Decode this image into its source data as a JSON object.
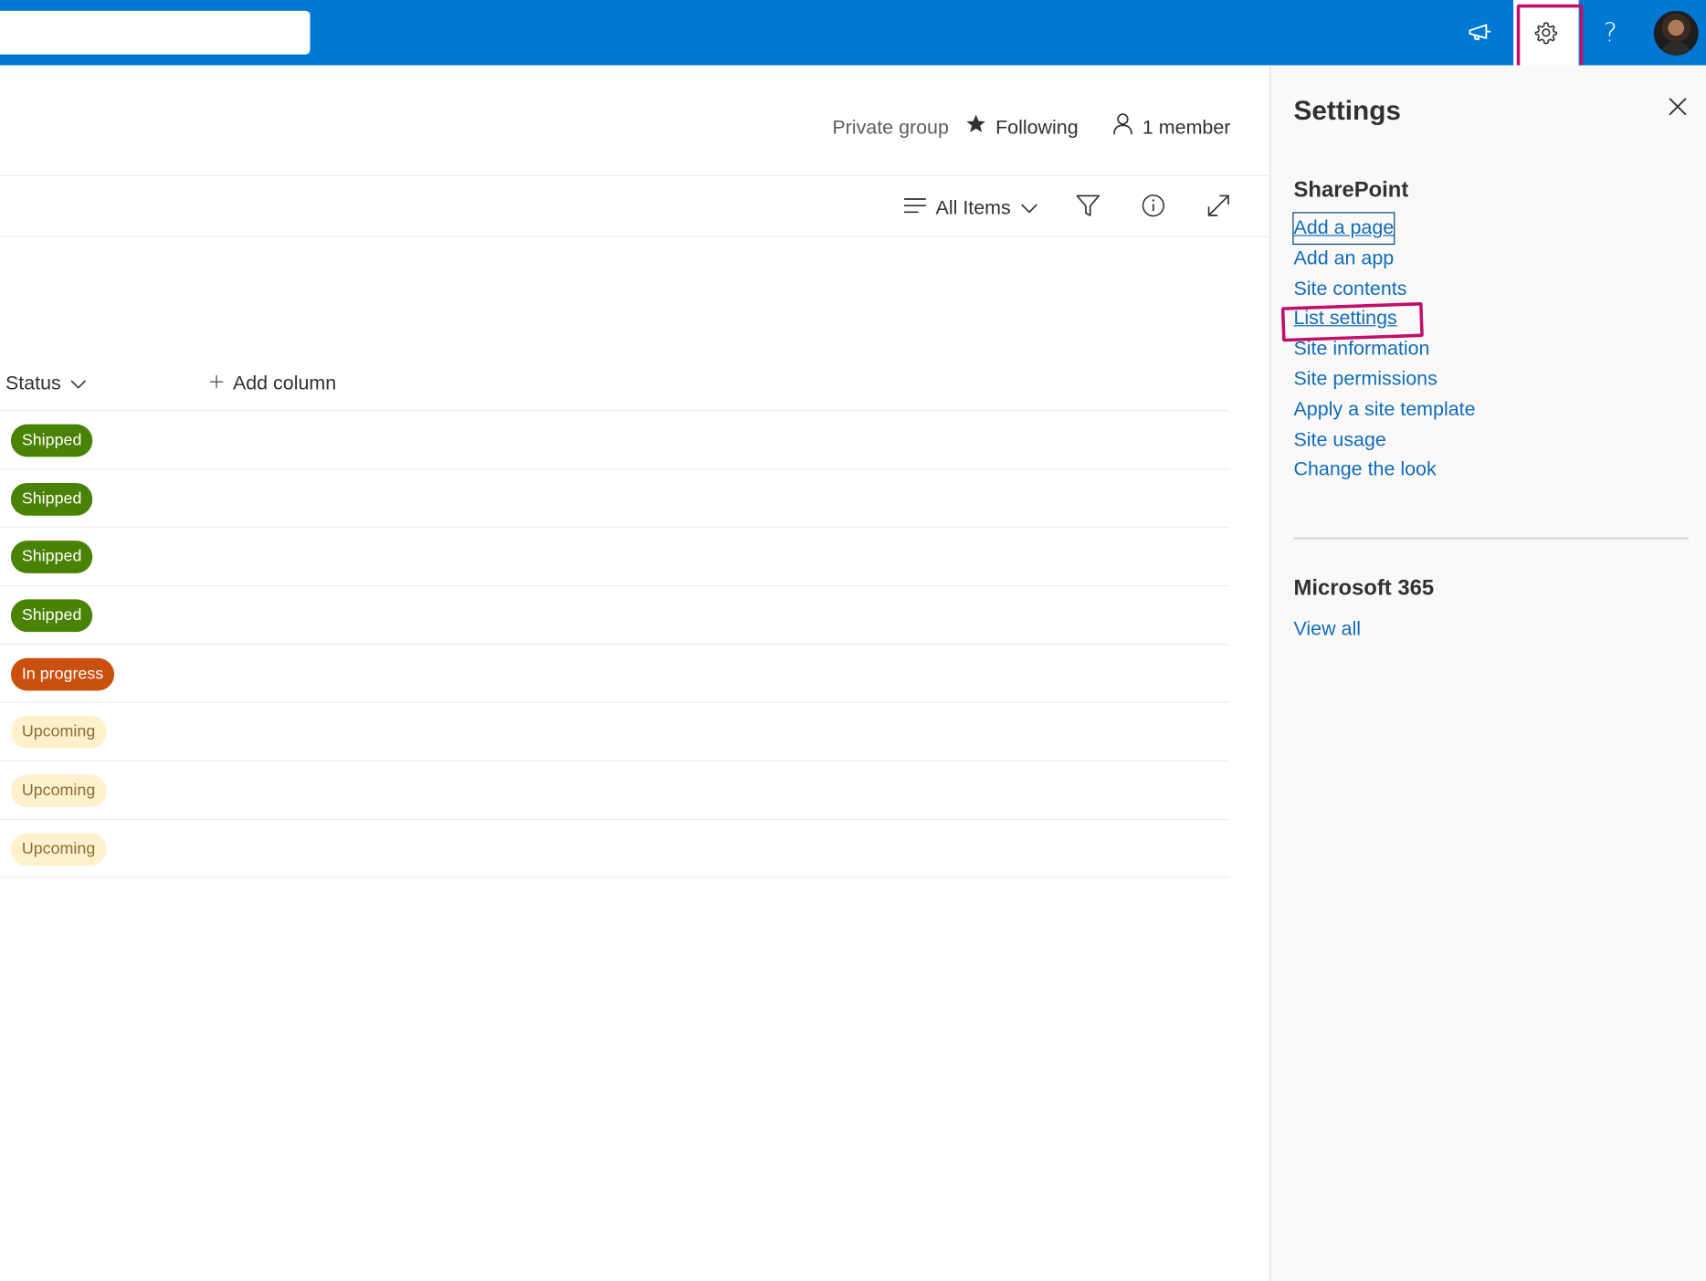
{
  "suite_bar": {
    "search_placeholder": "",
    "icons": [
      "announcement-icon",
      "gear-icon",
      "help-icon",
      "avatar"
    ],
    "help_glyph": "?"
  },
  "header": {
    "private_group": "Private group",
    "following": "Following",
    "members": "1 member"
  },
  "command_bar": {
    "view_label": "All Items",
    "icons": [
      "view-list-icon",
      "chevron-down-icon",
      "filter-icon",
      "info-icon",
      "expand-icon"
    ]
  },
  "list": {
    "columns": {
      "status": "Status",
      "add_column": "Add column"
    },
    "rows": [
      {
        "status": "Shipped",
        "kind": "shipped"
      },
      {
        "status": "Shipped",
        "kind": "shipped"
      },
      {
        "status": "Shipped",
        "kind": "shipped"
      },
      {
        "status": "Shipped",
        "kind": "shipped"
      },
      {
        "status": "In progress",
        "kind": "progress"
      },
      {
        "status": "Upcoming",
        "kind": "upcoming"
      },
      {
        "status": "Upcoming",
        "kind": "upcoming"
      },
      {
        "status": "Upcoming",
        "kind": "upcoming"
      }
    ]
  },
  "status_colors": {
    "shipped": {
      "bg": "#498205",
      "fg": "#ffffff"
    },
    "progress": {
      "bg": "#ca5010",
      "fg": "#ffffff"
    },
    "upcoming": {
      "bg": "#fff1cc",
      "fg": "#8a6d3b"
    }
  },
  "settings_panel": {
    "title": "Settings",
    "sharepoint_heading": "SharePoint",
    "links": [
      {
        "label": "Add a page",
        "style": "focused"
      },
      {
        "label": "Add an app",
        "style": ""
      },
      {
        "label": "Site contents",
        "style": ""
      },
      {
        "label": "List settings",
        "style": "underlined"
      },
      {
        "label": "Site information",
        "style": ""
      },
      {
        "label": "Site permissions",
        "style": ""
      },
      {
        "label": "Apply a site template",
        "style": ""
      },
      {
        "label": "Site usage",
        "style": ""
      },
      {
        "label": "Change the look",
        "style": ""
      }
    ],
    "m365_heading": "Microsoft 365",
    "view_all": "View all"
  },
  "colors": {
    "brand": "#0078d4",
    "link": "#0f6cbd",
    "annotation": "#c0106a"
  }
}
